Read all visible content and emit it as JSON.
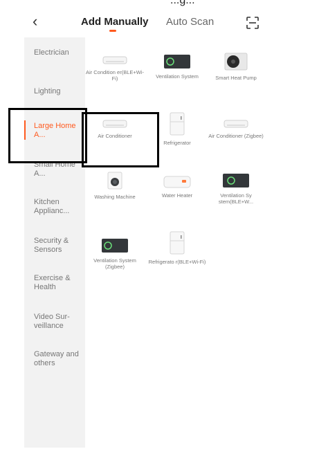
{
  "partial_top_text": "...g...",
  "header": {
    "back_icon": "chevron-left-icon",
    "tabs": [
      "Add Manually",
      "Auto Scan"
    ],
    "scan_icon": "scan-icon"
  },
  "sidebar": {
    "items": [
      {
        "label": "Electrician",
        "active": false
      },
      {
        "label": "Lighting",
        "active": false
      },
      {
        "label": "Large Home A...",
        "active": true
      },
      {
        "label": "Small Home A...",
        "active": false
      },
      {
        "label": "Kitchen Applianc...",
        "active": false
      },
      {
        "label": "Security & Sensors",
        "active": false
      },
      {
        "label": "Exercise & Health",
        "active": false
      },
      {
        "label": "Video Sur- veillance",
        "active": false
      },
      {
        "label": "Gateway and others",
        "active": false
      }
    ]
  },
  "products": [
    {
      "label": "Air Condition er(BLE+Wi-Fi)",
      "icon": "air-conditioner-icon"
    },
    {
      "label": "Ventilation System",
      "icon": "ventilation-system-icon"
    },
    {
      "label": "Smart Heat Pump",
      "icon": "heat-pump-icon"
    },
    {
      "label": "Air Conditioner",
      "icon": "air-conditioner-icon"
    },
    {
      "label": "Refrigerator",
      "icon": "refrigerator-icon"
    },
    {
      "label": "Air Conditioner (Zigbee)",
      "icon": "air-conditioner-icon"
    },
    {
      "label": "Washing Machine",
      "icon": "washing-machine-icon"
    },
    {
      "label": "Water Heater",
      "icon": "water-heater-icon"
    },
    {
      "label": "Ventilation Sy stem(BLE+W...",
      "icon": "ventilation-system-icon"
    },
    {
      "label": "Ventilation System (Zigbee)",
      "icon": "ventilation-system-icon"
    },
    {
      "label": "Refrigerato r(BLE+Wi-Fi)",
      "icon": "refrigerator-icon"
    }
  ],
  "colors": {
    "accent": "#ff5a1f",
    "sidebar_bg": "#f2f2f2"
  }
}
